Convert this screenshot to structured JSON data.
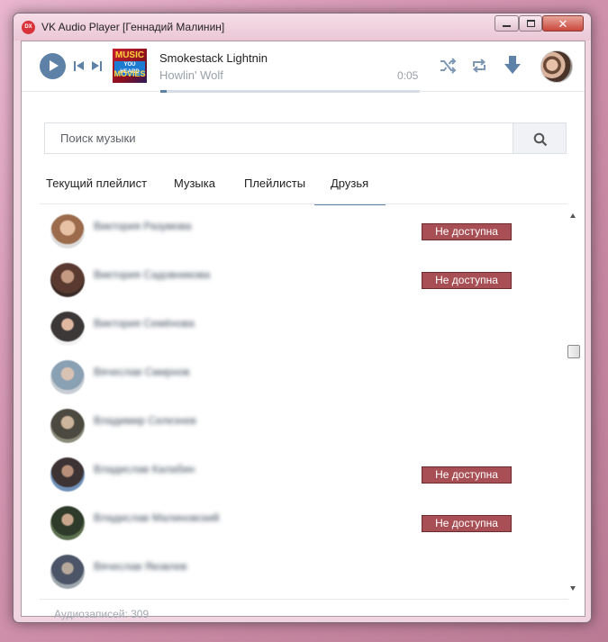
{
  "window": {
    "title": "VK Audio Player [Геннадий Малинин]",
    "app_icon_text": "DX"
  },
  "player": {
    "track_title": "Smokestack Lightnin",
    "artist": "Howlin' Wolf",
    "time": "0:05",
    "progress": 0.02,
    "cover": {
      "line1": "MUSIC",
      "line2": "YOU HEARD",
      "line3": "MOVIES"
    },
    "accent_color": "#5e81a8"
  },
  "search": {
    "placeholder": "Поиск музыки",
    "value": ""
  },
  "tabs": [
    {
      "label": "Текущий плейлист",
      "active": false
    },
    {
      "label": "Музыка",
      "active": false
    },
    {
      "label": "Плейлисты",
      "active": false
    },
    {
      "label": "Друзья",
      "active": true
    }
  ],
  "friends": [
    {
      "name": "Виктория Разумова",
      "status": "Не доступна"
    },
    {
      "name": "Виктория Садовникова",
      "status": "Не доступна"
    },
    {
      "name": "Виктория Семёнова",
      "status": ""
    },
    {
      "name": "Вячеслав Смирнов",
      "status": ""
    },
    {
      "name": "Владимир Селезнев",
      "status": ""
    },
    {
      "name": "Владислав Калабин",
      "status": "Не доступна"
    },
    {
      "name": "Владислав Малиновский",
      "status": "Не доступна"
    },
    {
      "name": "Вячеслав Яковлев",
      "status": ""
    }
  ],
  "footer": {
    "records_label": "Аудиозаписей: 309"
  },
  "colors": {
    "status_badge": "#a84f55",
    "tab_underline": "#5e81a8"
  }
}
